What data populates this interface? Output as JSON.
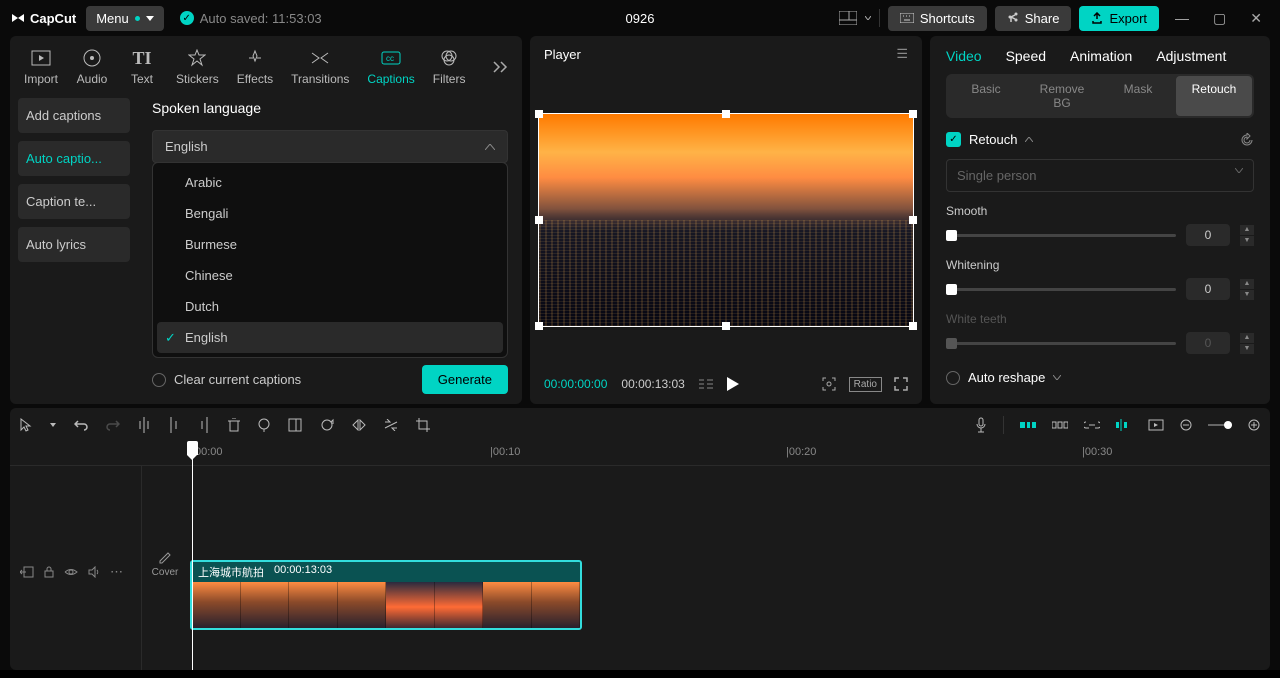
{
  "app": {
    "name": "CapCut"
  },
  "topbar": {
    "menu": "Menu",
    "autosave": "Auto saved: 11:53:03",
    "project": "0926",
    "shortcuts": "Shortcuts",
    "share": "Share",
    "export": "Export"
  },
  "media_tabs": {
    "import": "Import",
    "audio": "Audio",
    "text": "Text",
    "stickers": "Stickers",
    "effects": "Effects",
    "transitions": "Transitions",
    "captions": "Captions",
    "filters": "Filters"
  },
  "captions": {
    "sidebar": {
      "add": "Add captions",
      "auto": "Auto captio...",
      "template": "Caption te...",
      "lyrics": "Auto lyrics"
    },
    "spoken_language": "Spoken language",
    "selected_language": "English",
    "languages": [
      "Arabic",
      "Bengali",
      "Burmese",
      "Chinese",
      "Dutch",
      "English"
    ],
    "clear": "Clear current captions",
    "generate": "Generate"
  },
  "player": {
    "title": "Player",
    "current": "00:00:00:00",
    "total": "00:00:13:03",
    "ratio": "Ratio"
  },
  "inspector": {
    "tabs": {
      "video": "Video",
      "speed": "Speed",
      "animation": "Animation",
      "adjustment": "Adjustment"
    },
    "subtabs": {
      "basic": "Basic",
      "removebg": "Remove BG",
      "mask": "Mask",
      "retouch": "Retouch"
    },
    "retouch_label": "Retouch",
    "person_mode": "Single person",
    "sliders": {
      "smooth": {
        "label": "Smooth",
        "value": "0"
      },
      "whitening": {
        "label": "Whitening",
        "value": "0"
      },
      "white_teeth": {
        "label": "White teeth",
        "value": "0"
      }
    },
    "auto_reshape": "Auto reshape"
  },
  "timeline": {
    "marks": [
      {
        "pos": 185,
        "label": "00:00"
      },
      {
        "pos": 482,
        "label": "|00:10"
      },
      {
        "pos": 780,
        "label": "|00:20"
      },
      {
        "pos": 1076,
        "label": "|00:30"
      }
    ],
    "cover": "Cover",
    "clip": {
      "name": "上海城市航拍",
      "duration": "00:00:13:03"
    }
  }
}
